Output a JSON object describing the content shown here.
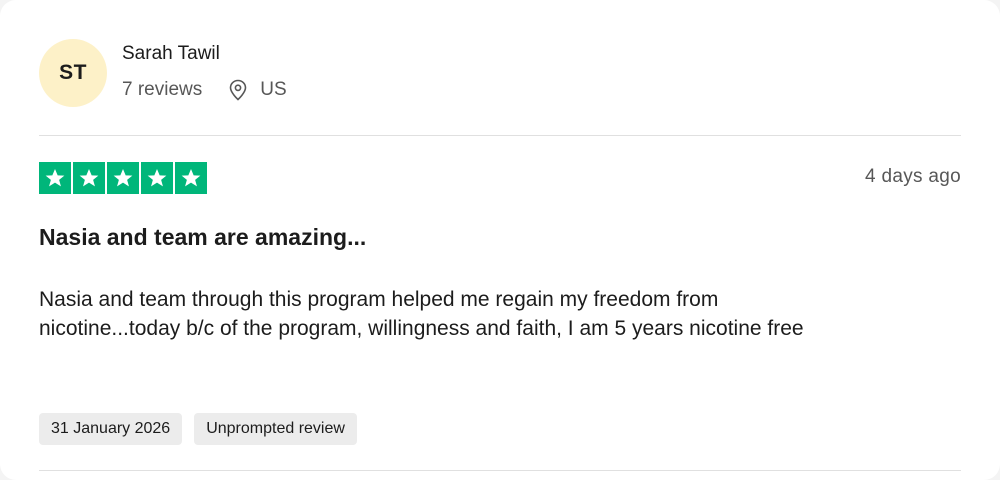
{
  "consumer": {
    "initials": "ST",
    "name": "Sarah Tawil",
    "reviews_count": "7 reviews",
    "location_icon": "location-pin-icon",
    "country": "US"
  },
  "review": {
    "rating": 5,
    "rating_max": 5,
    "star_color": "#00b67a",
    "date_ago": "4 days ago",
    "title": "Nasia and team are amazing...",
    "body": "Nasia and team through this program helped me regain my freedom from nicotine...today b/c of the program, willingness and faith, I am 5 years nicotine free",
    "tags": {
      "date_of_experience": "31 January 2026",
      "review_type": "Unprompted review"
    }
  }
}
